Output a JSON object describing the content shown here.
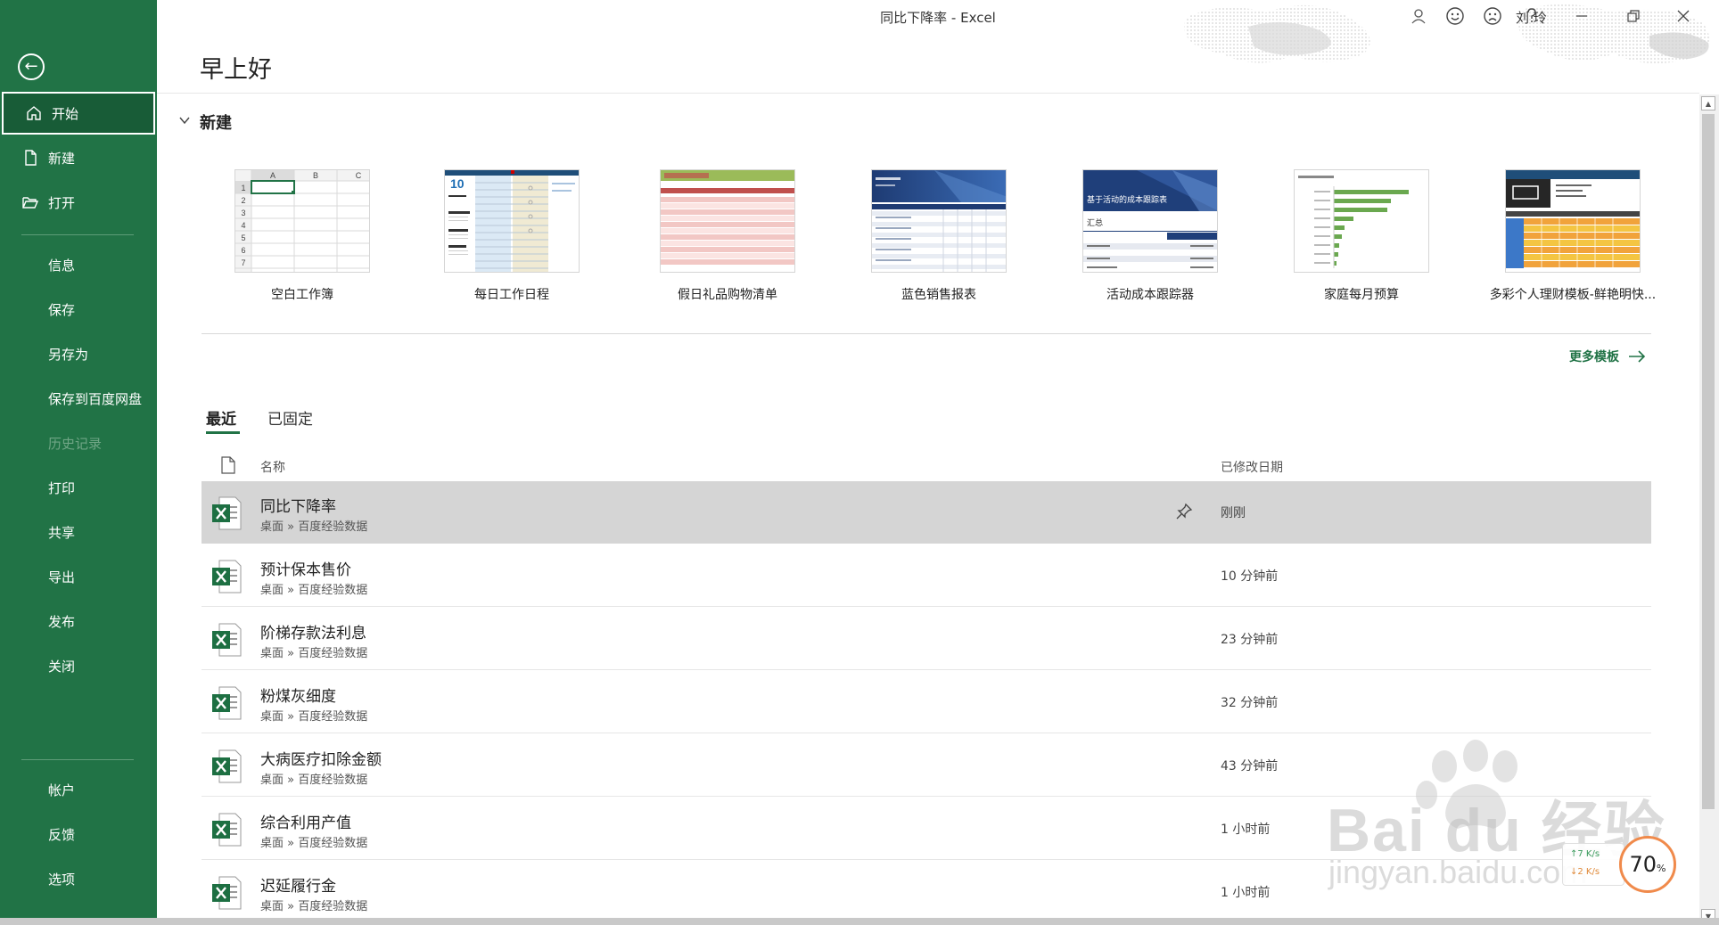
{
  "window": {
    "title": "同比下降率  -  Excel",
    "user_name": "刘 玲"
  },
  "sidebar": {
    "back_label": "←",
    "items": [
      {
        "label": "开始"
      },
      {
        "label": "新建"
      },
      {
        "label": "打开"
      },
      {
        "label": "信息"
      },
      {
        "label": "保存"
      },
      {
        "label": "另存为"
      },
      {
        "label": "保存到百度网盘"
      },
      {
        "label": "历史记录"
      },
      {
        "label": "打印"
      },
      {
        "label": "共享"
      },
      {
        "label": "导出"
      },
      {
        "label": "发布"
      },
      {
        "label": "关闭"
      },
      {
        "label": "帐户"
      },
      {
        "label": "反馈"
      },
      {
        "label": "选项"
      }
    ]
  },
  "main": {
    "greeting": "早上好",
    "new_section": {
      "heading": "新建",
      "templates": [
        {
          "label": "空白工作簿"
        },
        {
          "label": "每日工作日程"
        },
        {
          "label": "假日礼品购物清单"
        },
        {
          "label": "蓝色销售报表"
        },
        {
          "label": "活动成本跟踪器"
        },
        {
          "label": "家庭每月预算"
        },
        {
          "label": "多彩个人理财模板-鲜艳明快..."
        }
      ],
      "more_templates": "更多模板",
      "blank_workbook": {
        "cols": [
          "A",
          "B",
          "C"
        ],
        "rows": [
          "1",
          "2",
          "3",
          "4",
          "5",
          "6",
          "7"
        ]
      },
      "daily_schedule": {
        "date_number": "10"
      },
      "cost_tracker": {
        "title": "基于活动的成本跟踪表",
        "summary": "汇总"
      }
    },
    "tabs": {
      "recent": "最近",
      "pinned": "已固定"
    },
    "list": {
      "header_name": "名称",
      "header_date": "已修改日期",
      "files": [
        {
          "name": "同比下降率",
          "path": "桌面 » 百度经验数据",
          "date": "刚刚"
        },
        {
          "name": "预计保本售价",
          "path": "桌面 » 百度经验数据",
          "date": "10 分钟前"
        },
        {
          "name": "阶梯存款法利息",
          "path": "桌面 » 百度经验数据",
          "date": "23 分钟前"
        },
        {
          "name": "粉煤灰细度",
          "path": "桌面 » 百度经验数据",
          "date": "32 分钟前"
        },
        {
          "name": "大病医疗扣除金额",
          "path": "桌面 » 百度经验数据",
          "date": "43 分钟前"
        },
        {
          "name": "综合利用产值",
          "path": "桌面 » 百度经验数据",
          "date": "1 小时前"
        },
        {
          "name": "迟延履行金",
          "path": "桌面 » 百度经验数据",
          "date": "1 小时前"
        }
      ]
    }
  },
  "watermark": {
    "text": "Bai du 经验",
    "url": "jingyan.baidu.com"
  },
  "net_widget": {
    "up": "↑7  K/s",
    "down": "↓2  K/s",
    "percent": "70",
    "percent_sign": "%"
  },
  "colors": {
    "accent": "#217346",
    "accent_dark": "#185c37",
    "selected_row": "#d5d5d5",
    "ring": "#f08a4b"
  }
}
